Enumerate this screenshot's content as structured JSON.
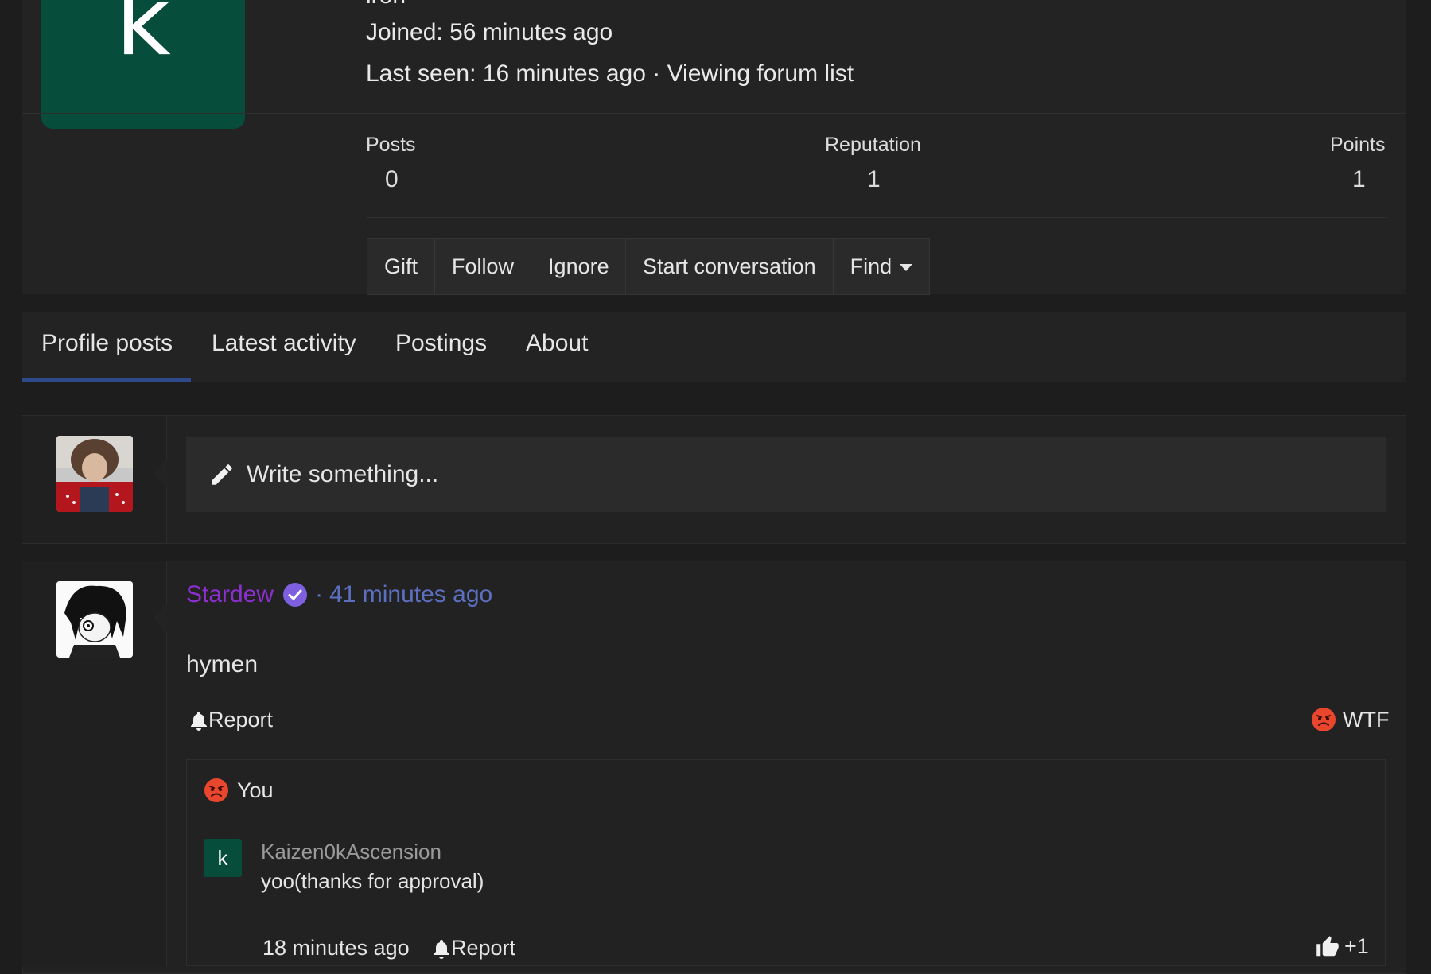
{
  "profile": {
    "cut_text": "iron",
    "joined": "Joined: 56 minutes ago",
    "last_seen_prefix": "Last seen: 16 minutes ago · ",
    "last_seen_activity": "Viewing forum list",
    "avatar_letter": "k",
    "stats": [
      {
        "label": "Posts",
        "value": "0"
      },
      {
        "label": "Reputation",
        "value": "1"
      },
      {
        "label": "Points",
        "value": "1"
      }
    ],
    "actions": {
      "gift": "Gift",
      "follow": "Follow",
      "ignore": "Ignore",
      "start_conversation": "Start conversation",
      "find": "Find"
    }
  },
  "tabs": [
    {
      "label": "Profile posts",
      "active": true
    },
    {
      "label": "Latest activity",
      "active": false
    },
    {
      "label": "Postings",
      "active": false
    },
    {
      "label": "About",
      "active": false
    }
  ],
  "composer": {
    "placeholder": "Write something..."
  },
  "post": {
    "author": "Stardew",
    "separator": "·",
    "time": "41 minutes ago",
    "message": "hymen",
    "report_label": "Report",
    "reaction_label": "WTF",
    "reaction_list_label": "You",
    "comment": {
      "avatar_letter": "k",
      "author": "Kaizen0kAscension",
      "text": "yoo(thanks for approval)",
      "time": "18 minutes ago",
      "report_label": "Report",
      "reaction_count": "+1"
    }
  },
  "colors": {
    "avatar_bg": "#064d3b",
    "username": "#8d2fd0",
    "link": "#5c6fc0",
    "tab_underline": "#2e4a8a",
    "verified_badge": "#7d5fe0",
    "angry_emoji": "#e8472e"
  }
}
